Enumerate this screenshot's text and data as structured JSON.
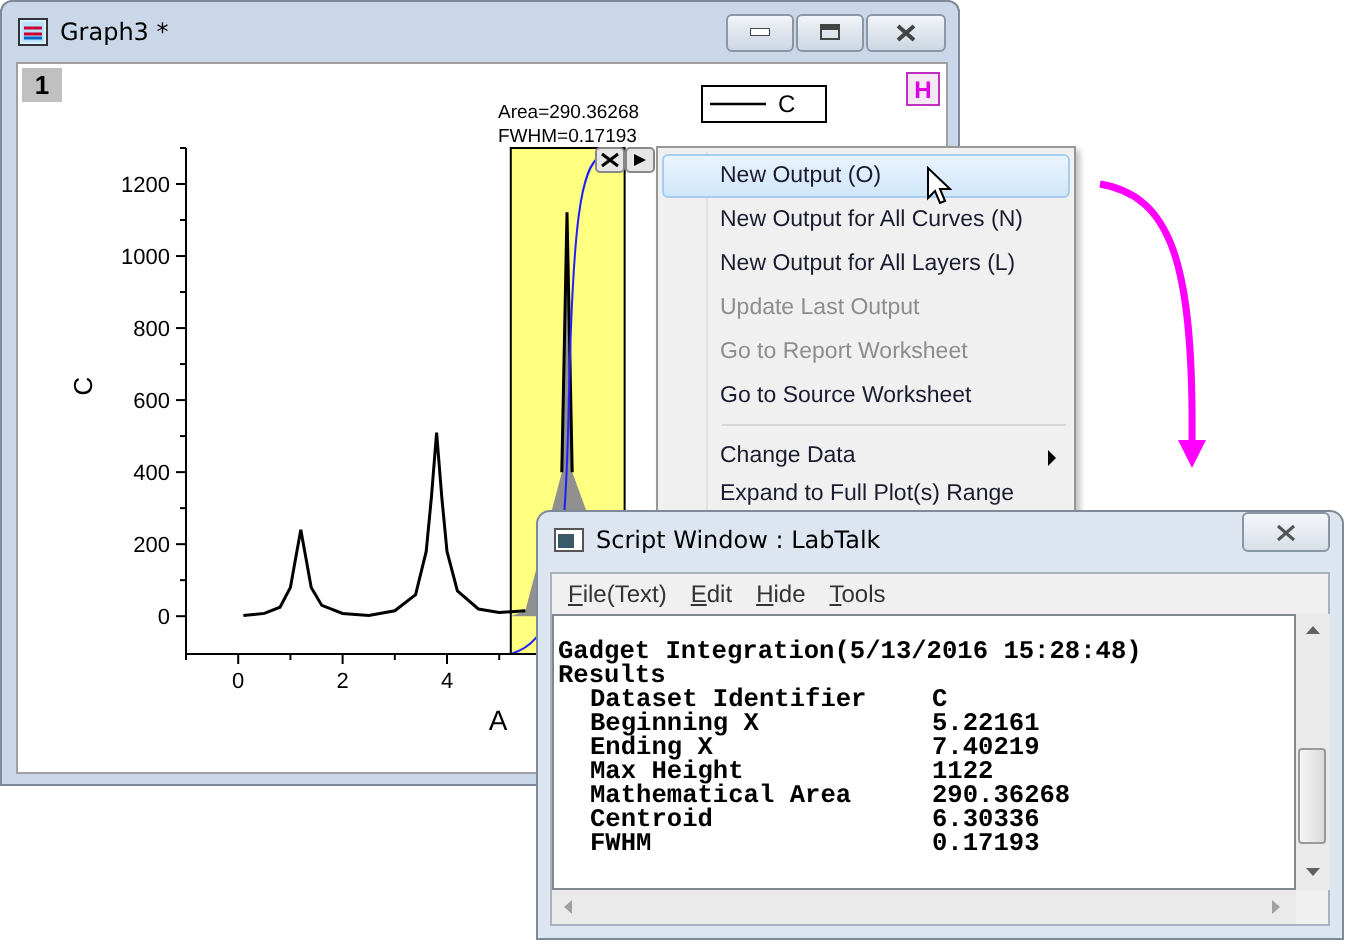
{
  "graph_window": {
    "title": "Graph3 *",
    "layer_label": "1",
    "h_button": "H",
    "gadget": {
      "area_label": "Area=290.36268",
      "fwhm_label": "FWHM=0.17193"
    },
    "chart_data": {
      "type": "line",
      "xlabel": "A",
      "ylabel": "C",
      "x": [
        0.1,
        0.5,
        0.8,
        1.0,
        1.1,
        1.2,
        1.3,
        1.4,
        1.6,
        2.0,
        2.5,
        3.0,
        3.4,
        3.6,
        3.7,
        3.8,
        3.9,
        4.0,
        4.2,
        4.6,
        5.0,
        5.5,
        6.0,
        6.2,
        6.3,
        6.4
      ],
      "series": [
        {
          "name": "C",
          "color": "#000000",
          "values": [
            2,
            8,
            25,
            80,
            160,
            240,
            160,
            80,
            30,
            8,
            2,
            15,
            60,
            180,
            330,
            510,
            330,
            180,
            70,
            20,
            10,
            15,
            null,
            400,
            1122,
            400
          ]
        }
      ],
      "xticks": [
        0,
        2,
        4
      ],
      "yticks": [
        0,
        200,
        400,
        600,
        800,
        1000,
        1200
      ],
      "xlim": [
        -1,
        8.08
      ],
      "ylim": [
        -105,
        1300
      ]
    }
  },
  "context_menu": {
    "items": [
      {
        "kind": "item",
        "label": "New Output (O)",
        "selected": true,
        "disabled": false,
        "submenu": false
      },
      {
        "kind": "item",
        "label": "New Output for All Curves (N)",
        "selected": false,
        "disabled": false,
        "submenu": false
      },
      {
        "kind": "item",
        "label": "New Output for All Layers (L)",
        "selected": false,
        "disabled": false,
        "submenu": false
      },
      {
        "kind": "item",
        "label": "Update Last Output",
        "selected": false,
        "disabled": true,
        "submenu": false
      },
      {
        "kind": "item",
        "label": "Go to Report Worksheet",
        "selected": false,
        "disabled": true,
        "submenu": false
      },
      {
        "kind": "item",
        "label": "Go to Source Worksheet",
        "selected": false,
        "disabled": false,
        "submenu": false
      },
      {
        "kind": "separator"
      },
      {
        "kind": "item",
        "label": "Change Data",
        "selected": false,
        "disabled": false,
        "submenu": true
      },
      {
        "kind": "item",
        "label": "Expand to Full Plot(s) Range",
        "selected": false,
        "disabled": false,
        "submenu": false
      }
    ]
  },
  "script_window": {
    "title": "Script Window : LabTalk",
    "menus": [
      "File(Text)",
      "Edit",
      "Hide",
      "Tools"
    ],
    "header": "Gadget Integration(5/13/2016 15:28:48)",
    "section": "Results",
    "rows": [
      {
        "label": "Dataset Identifier",
        "value": "C"
      },
      {
        "label": "Beginning X",
        "value": "5.22161"
      },
      {
        "label": "Ending X",
        "value": "7.40219"
      },
      {
        "label": "Max Height",
        "value": "1122"
      },
      {
        "label": "Mathematical Area",
        "value": "290.36268"
      },
      {
        "label": "Centroid",
        "value": "6.30336"
      },
      {
        "label": "FWHM",
        "value": "0.17193"
      }
    ]
  }
}
